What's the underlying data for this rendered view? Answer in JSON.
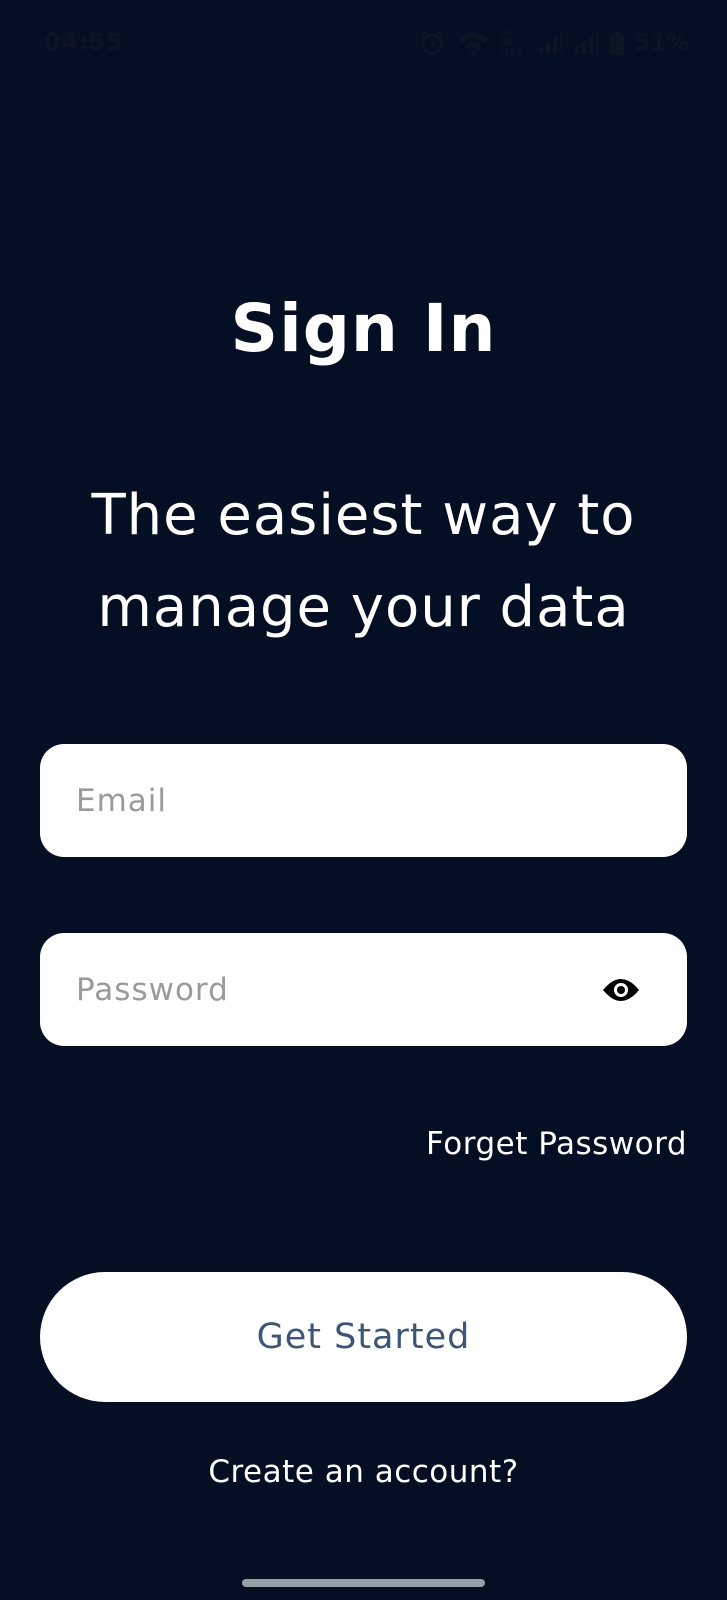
{
  "status_bar": {
    "time": "04:55",
    "network_label_top": "Vo 5G",
    "network_label_bottom": "LTE2",
    "battery": "51%",
    "icons": [
      "alarm-icon",
      "wifi-icon",
      "signal-icon",
      "signal-icon",
      "battery-icon"
    ]
  },
  "title": "Sign In",
  "subtitle": "The easiest way to manage your data",
  "email": {
    "placeholder": "Email",
    "value": ""
  },
  "password": {
    "placeholder": "Password",
    "value": "",
    "toggle_icon": "eye-icon"
  },
  "forget_password_label": "Forget Password",
  "get_started_label": "Get Started",
  "create_account_label": "Create an account?",
  "colors": {
    "background": "#050f24",
    "field_background": "#ffffff",
    "button_text": "#3d5577",
    "placeholder": "#9a9a9a"
  }
}
